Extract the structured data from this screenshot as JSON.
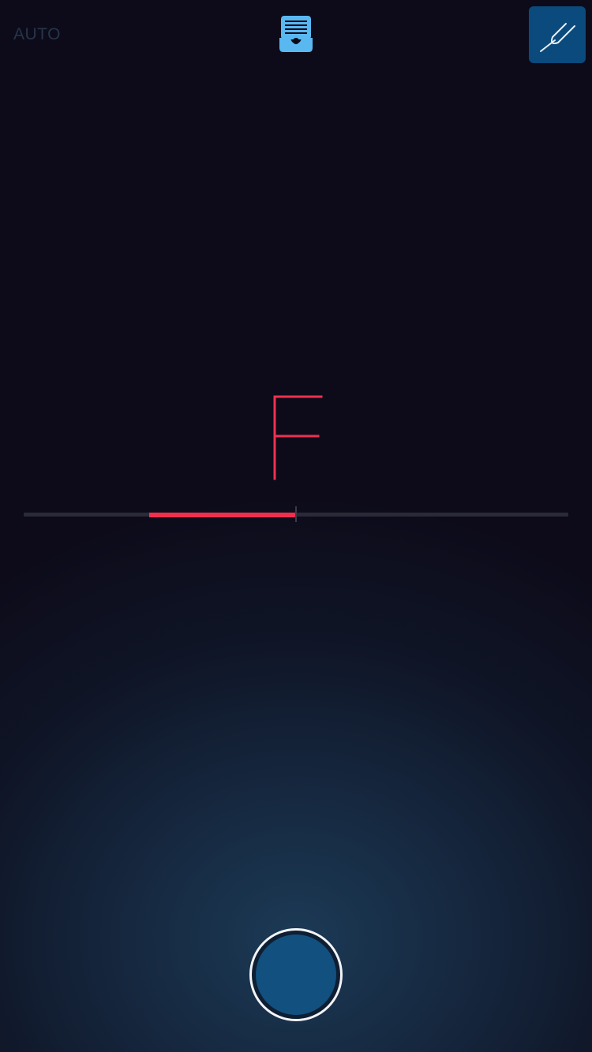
{
  "header": {
    "mode_label": "AUTO",
    "tray_icon": "tray-list-icon",
    "fork_icon": "tuning-fork-icon"
  },
  "tuner": {
    "note": "F",
    "deviation_fraction": -0.54
  },
  "controls": {
    "play_icon": "play-circle-button"
  },
  "colors": {
    "background_top": "#0d0b1a",
    "background_bottom": "#1c3a56",
    "note_color": "#f0304e",
    "meter_fill": "#f0304e",
    "meter_track": "#2a2a38",
    "accent_blue": "#0b4a7c",
    "tray_blue": "#5ab8f0",
    "button_blue": "#11507f",
    "mode_label": "#26354a"
  }
}
